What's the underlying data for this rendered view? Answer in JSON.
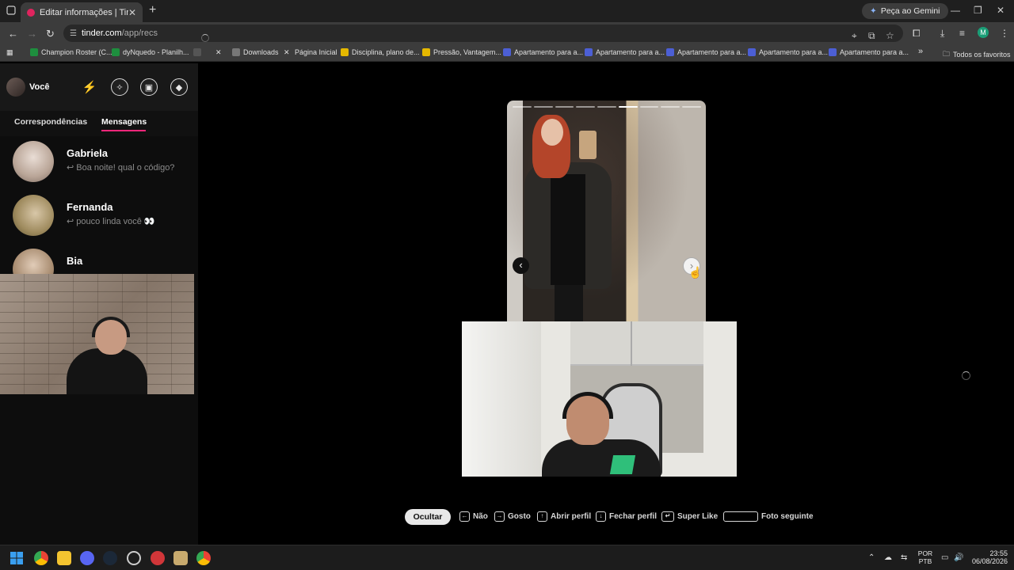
{
  "browser": {
    "tab_title": "Editar informações | Tinder",
    "new_tab": "+",
    "gemini_label": "Peça ao Gemini",
    "url_host": "tinder.com",
    "url_path": "/app/recs",
    "profile_initial": "M",
    "bookmarks": [
      {
        "label": "Champion Roster (C...",
        "color": "#1e8e3e"
      },
      {
        "label": "dyNquedo - Planilh...",
        "color": "#1e8e3e"
      },
      {
        "label": "",
        "color": "#555555"
      },
      {
        "label": "",
        "color": "#000000"
      },
      {
        "label": "Downloads",
        "color": "#777777"
      },
      {
        "label": "Página Inicial",
        "color": "#000000"
      },
      {
        "label": "Disciplina, plano de...",
        "color": "#e5b800"
      },
      {
        "label": "Pressão, Vantagem...",
        "color": "#e5b800"
      },
      {
        "label": "Apartamento para a...",
        "color": "#4c5fd5"
      },
      {
        "label": "Apartamento para a...",
        "color": "#4c5fd5"
      },
      {
        "label": "Apartamento para a...",
        "color": "#4c5fd5"
      },
      {
        "label": "Apartamento para a...",
        "color": "#4c5fd5"
      },
      {
        "label": "Apartamento para a...",
        "color": "#4c5fd5"
      }
    ],
    "more_bookmarks": "»",
    "all_bookmarks": "Todos os favoritos"
  },
  "sidebar": {
    "user_name": "Você",
    "tabs": {
      "matches": "Correspondências",
      "messages": "Mensagens"
    },
    "conversations": [
      {
        "name": "Gabriela",
        "preview": "↩ Boa noite! qual o código?"
      },
      {
        "name": "Fernanda",
        "preview": "↩ pouco linda você 👀"
      },
      {
        "name": "Bia",
        "preview": ""
      }
    ]
  },
  "card": {
    "photo_count": 9,
    "active_photo": 6
  },
  "shortcuts": {
    "hide": "Ocultar",
    "items": [
      {
        "key": "←",
        "label": "Não"
      },
      {
        "key": "→",
        "label": "Gosto"
      },
      {
        "key": "↑",
        "label": "Abrir perfil"
      },
      {
        "key": "↓",
        "label": "Fechar perfil"
      },
      {
        "key": "↵",
        "label": "Super Like"
      },
      {
        "key": "",
        "label": "Foto seguinte"
      }
    ]
  },
  "taskbar": {
    "language": "POR",
    "layout": "PTB",
    "time": "23:55",
    "date": "06/08/2026"
  },
  "colors": {
    "accent": "#fd267a",
    "boost": "#e36fd4"
  }
}
